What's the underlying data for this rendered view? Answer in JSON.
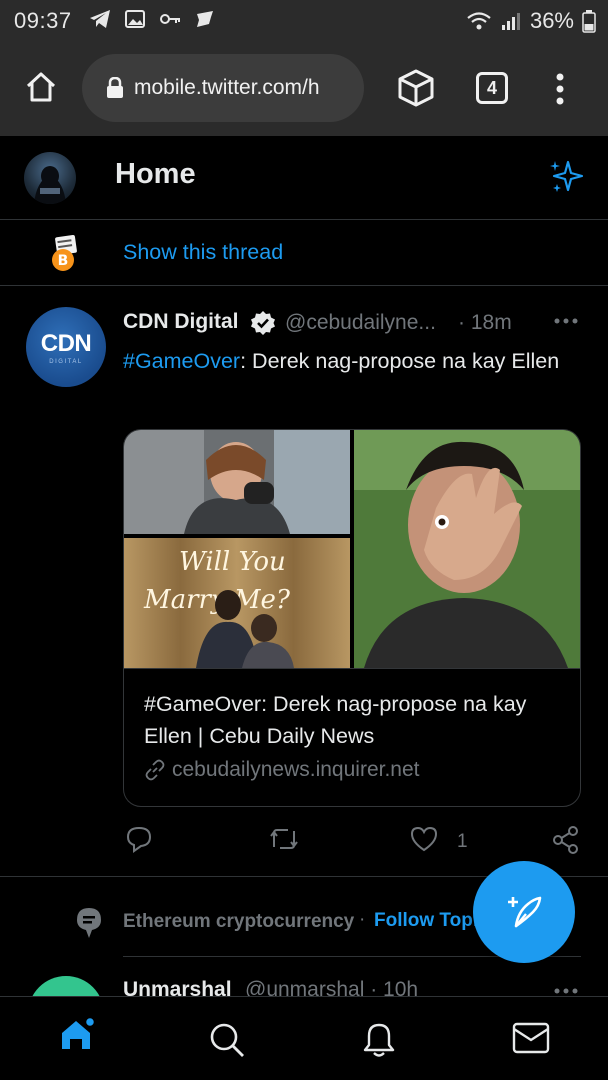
{
  "status_bar": {
    "time": "09:37",
    "battery": "36%"
  },
  "browser": {
    "url": "mobile.twitter.com/h",
    "tab_count": "4"
  },
  "header": {
    "title": "Home"
  },
  "thread": {
    "show_thread_label": "Show this thread"
  },
  "tweet": {
    "author_name": "CDN Digital",
    "author_handle": "@cebudailyne...",
    "separator": "·",
    "time": "18m",
    "avatar_text": "CDN",
    "avatar_subtext": "DIGITAL",
    "hashtag": "#GameOver",
    "text_rest": ": Derek nag-propose na kay Ellen",
    "card": {
      "image_text_line1": "Will You",
      "image_text_line2": "Marry Me?",
      "title": "#GameOver: Derek nag-propose na kay Ellen | Cebu Daily News",
      "domain": "cebudailynews.inquirer.net"
    },
    "like_count": "1"
  },
  "topic": {
    "label": "Ethereum cryptocurrency",
    "dot": "·",
    "follow_label": "Follow Topic"
  },
  "next_tweet": {
    "author_name": "Unmarshal",
    "author_handle": "@unmarshal · 10h"
  },
  "colors": {
    "accent": "#1d9bf0",
    "background": "#000000",
    "browser_chrome": "#2b2b2b",
    "muted_text": "#71767b",
    "divider": "#2f3336"
  }
}
